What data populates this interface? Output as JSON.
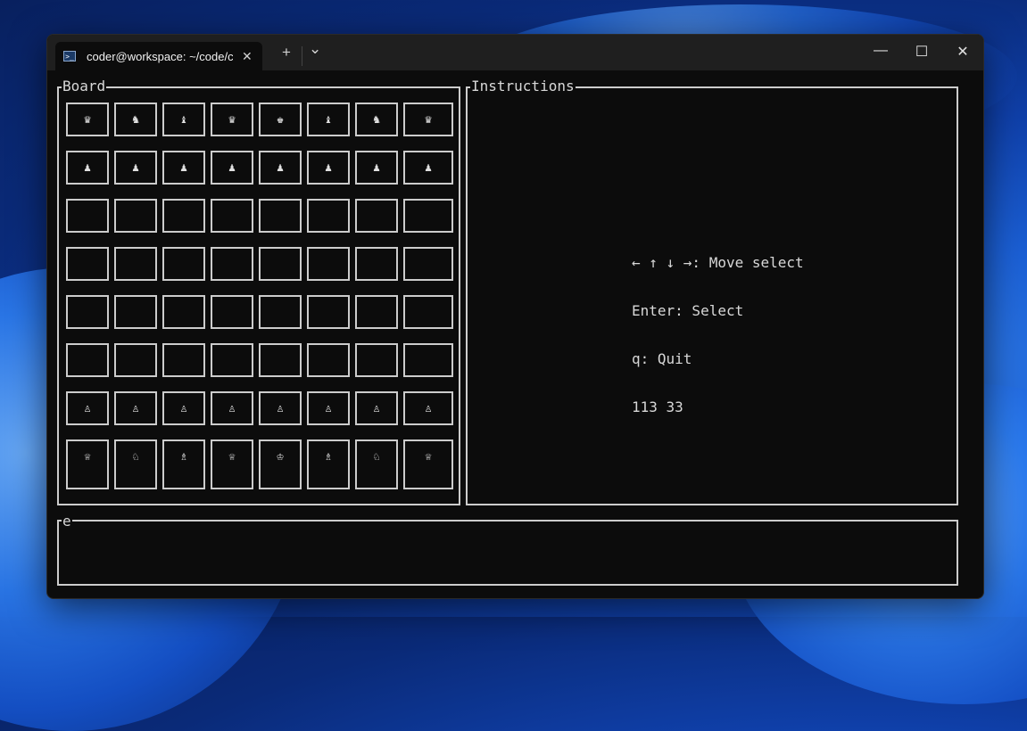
{
  "window": {
    "tab_title": "coder@workspace: ~/code/ch",
    "tab_icon": "terminal-icon",
    "new_tab_label": "+",
    "dropdown_label": "⌄",
    "close_tab_label": "✕",
    "minimize_label": "—",
    "maximize_label": "☐",
    "close_label": "✕"
  },
  "board": {
    "title": "Board",
    "rows": [
      [
        "♛",
        "♞",
        "♝",
        "♛",
        "♚",
        "♝",
        "♞",
        "♛"
      ],
      [
        "♟",
        "♟",
        "♟",
        "♟",
        "♟",
        "♟",
        "♟",
        "♟"
      ],
      [
        "",
        "",
        "",
        "",
        "",
        "",
        "",
        ""
      ],
      [
        "",
        "",
        "",
        "",
        "",
        "",
        "",
        ""
      ],
      [
        "",
        "",
        "",
        "",
        "",
        "",
        "",
        ""
      ],
      [
        "",
        "",
        "",
        "",
        "",
        "",
        "",
        ""
      ],
      [
        "♙",
        "♙",
        "♙",
        "♙",
        "♙",
        "♙",
        "♙",
        "♙"
      ],
      [
        "♕",
        "♘",
        "♗",
        "♕",
        "♔",
        "♗",
        "♘",
        "♕"
      ]
    ]
  },
  "instructions": {
    "title": "Instructions",
    "lines": [
      "← ↑ ↓ →: Move select",
      "Enter: Select",
      "q: Quit",
      "113 33"
    ]
  },
  "log": {
    "title": "e"
  },
  "colors": {
    "terminal_bg": "#0c0c0c",
    "titlebar_bg": "#1f1f1f",
    "border": "#cccccc",
    "text": "#d8d8d8"
  }
}
